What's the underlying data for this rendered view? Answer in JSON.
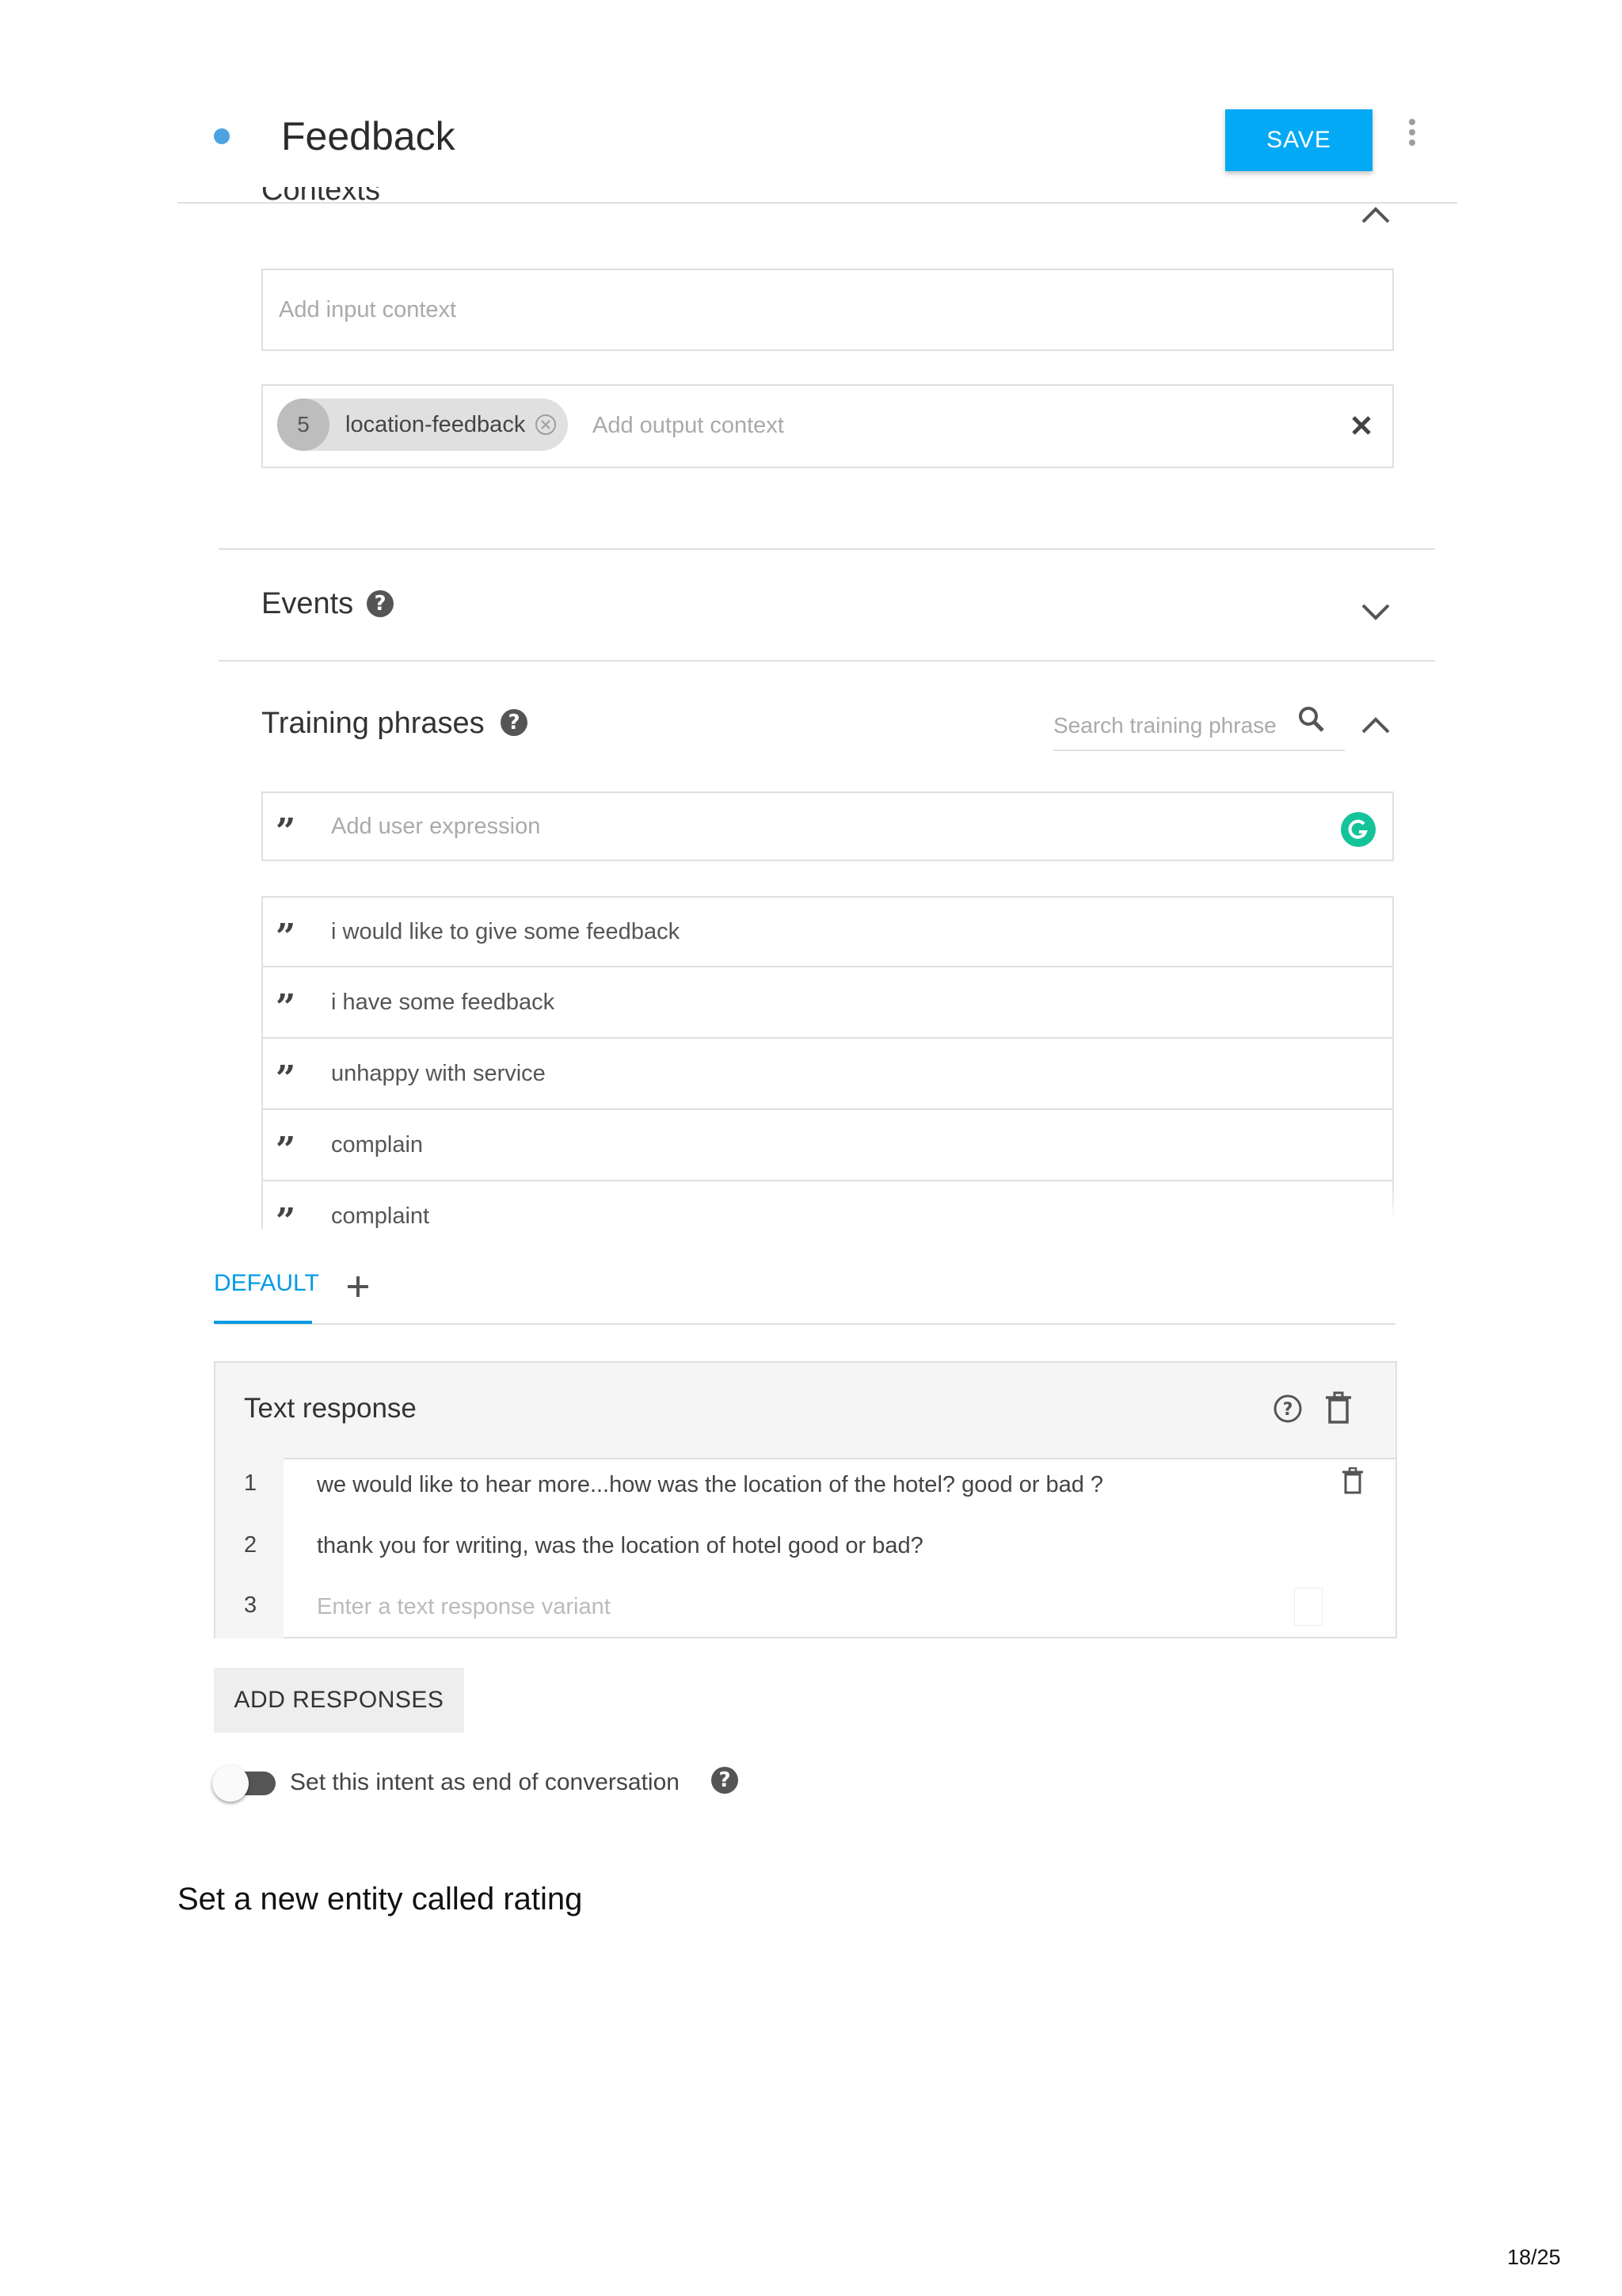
{
  "header": {
    "title": "Feedback",
    "save_label": "SAVE"
  },
  "contexts": {
    "title": "Contexts",
    "input_placeholder": "Add input context",
    "output_placeholder": "Add output context",
    "chip": {
      "count": "5",
      "label": "location-feedback"
    }
  },
  "events": {
    "title": "Events"
  },
  "training": {
    "title": "Training phrases",
    "search_placeholder": "Search training phrase",
    "add_placeholder": "Add user expression",
    "phrases": [
      "i would like to give some feedback",
      "i have some feedback",
      "unhappy with service",
      "complain",
      "complaint"
    ]
  },
  "responses": {
    "tab_default": "DEFAULT",
    "tab_add": "+",
    "card_title": "Text response",
    "rows": [
      {
        "num": "1",
        "text": "we would like to hear more...how was the location of the hotel? good or bad ?"
      },
      {
        "num": "2",
        "text": "thank you for writing, was the location of hotel good or bad?"
      },
      {
        "num": "3",
        "placeholder": "Enter a text response variant"
      }
    ],
    "add_label": "ADD RESPONSES",
    "end_conversation_label": "Set this intent as end of conversation"
  },
  "document": {
    "caption": "Set a new entity called rating",
    "page": "18/25"
  },
  "colors": {
    "accent": "#03a9f4",
    "grammarly": "#15c39a"
  }
}
